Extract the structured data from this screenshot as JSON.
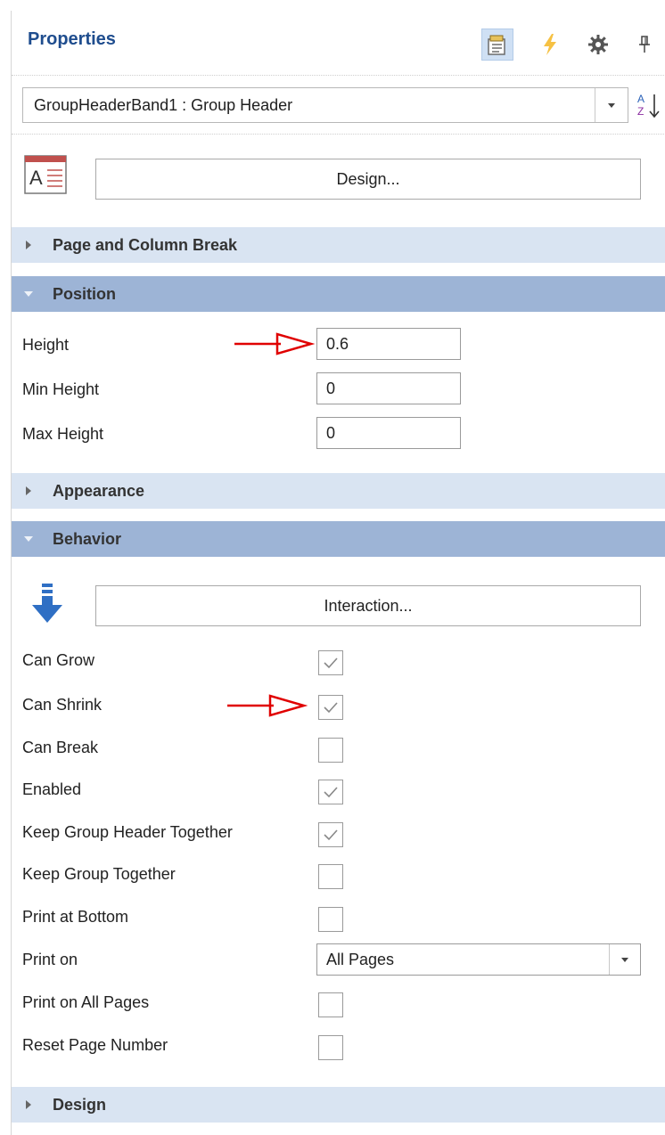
{
  "panel": {
    "title": "Properties",
    "toolbar": {
      "properties_icon": "properties-icon",
      "events_icon": "lightning-icon",
      "settings_icon": "gear-icon",
      "pin_icon": "pin-icon"
    }
  },
  "object_selector": {
    "value": "GroupHeaderBand1 : Group Header",
    "sort_icon": "sort-az-icon"
  },
  "buttons": {
    "design": "Design...",
    "interaction": "Interaction..."
  },
  "categories": {
    "page_break": "Page and Column Break",
    "position": "Position",
    "appearance": "Appearance",
    "behavior": "Behavior",
    "design": "Design"
  },
  "position": {
    "height": {
      "label": "Height",
      "value": "0.6"
    },
    "min_height": {
      "label": "Min Height",
      "value": "0"
    },
    "max_height": {
      "label": "Max Height",
      "value": "0"
    }
  },
  "behavior": {
    "can_grow": {
      "label": "Can Grow",
      "checked": true
    },
    "can_shrink": {
      "label": "Can Shrink",
      "checked": true
    },
    "can_break": {
      "label": "Can Break",
      "checked": false
    },
    "enabled": {
      "label": "Enabled",
      "checked": true
    },
    "keep_group_header_together": {
      "label": "Keep Group Header Together",
      "checked": true
    },
    "keep_group_together": {
      "label": "Keep Group Together",
      "checked": false
    },
    "print_at_bottom": {
      "label": "Print at Bottom",
      "checked": false
    },
    "print_on": {
      "label": "Print on",
      "value": "All Pages"
    },
    "print_on_all_pages": {
      "label": "Print on All Pages",
      "checked": false
    },
    "reset_page_number": {
      "label": "Reset Page Number",
      "checked": false
    }
  },
  "colors": {
    "title": "#1f4d8e",
    "category_collapsed": "#d9e4f2",
    "category_expanded": "#9db4d6",
    "annotation_arrow": "#e00000"
  }
}
